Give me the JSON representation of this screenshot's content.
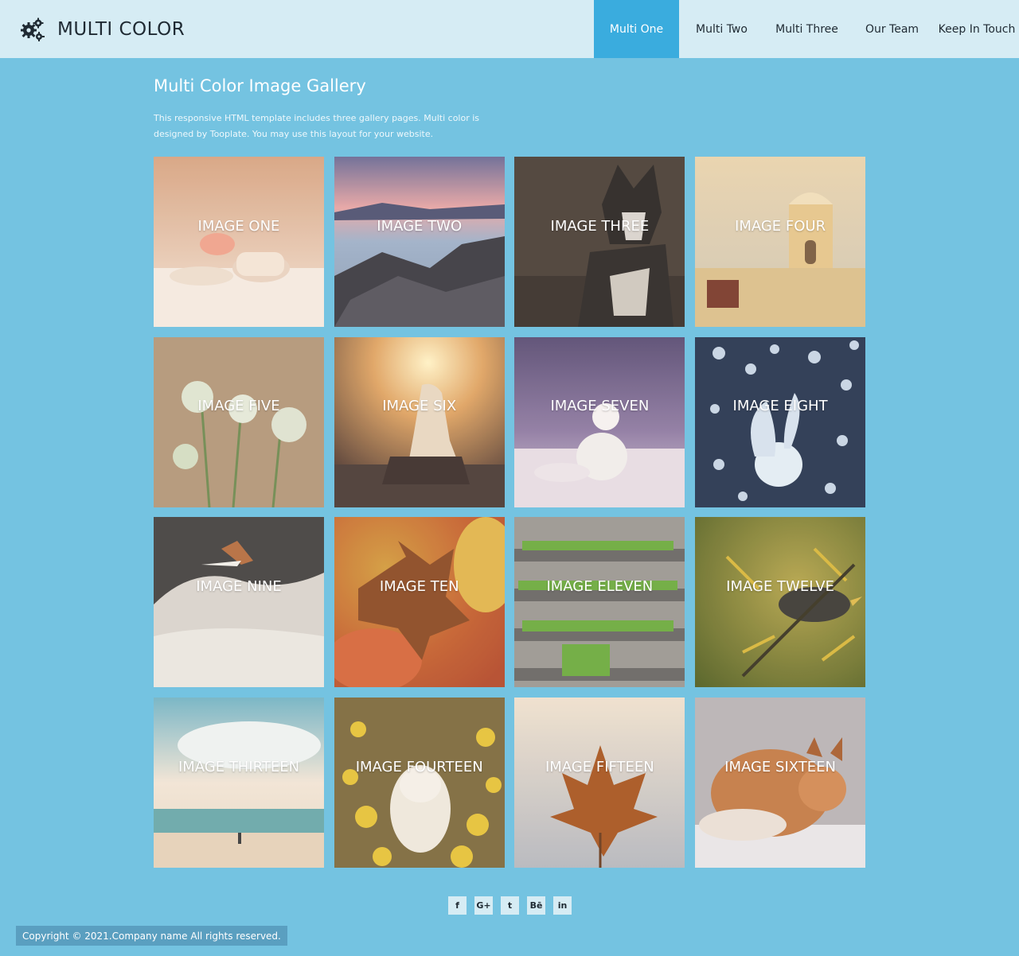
{
  "header": {
    "brand": "MULTI COLOR",
    "brand_icon": "gears-icon",
    "nav": [
      {
        "label": "Multi One",
        "active": true
      },
      {
        "label": "Multi Two",
        "active": false
      },
      {
        "label": "Multi Three",
        "active": false
      },
      {
        "label": "Our Team",
        "active": false
      },
      {
        "label": "Keep In Touch",
        "active": false
      }
    ]
  },
  "intro": {
    "title": "Multi Color Image Gallery",
    "description": "This responsive HTML template includes three gallery pages. Multi color is designed by Tooplate. You may use this layout for your website."
  },
  "gallery": [
    {
      "label": "IMAGE ONE"
    },
    {
      "label": "IMAGE TWO"
    },
    {
      "label": "IMAGE THREE"
    },
    {
      "label": "IMAGE FOUR"
    },
    {
      "label": "IMAGE FIVE"
    },
    {
      "label": "IMAGE SIX"
    },
    {
      "label": "IMAGE SEVEN"
    },
    {
      "label": "IMAGE EIGHT"
    },
    {
      "label": "IMAGE NINE"
    },
    {
      "label": "IMAGE TEN"
    },
    {
      "label": "IMAGE ELEVEN"
    },
    {
      "label": "IMAGE TWELVE"
    },
    {
      "label": "IMAGE THIRTEEN"
    },
    {
      "label": "IMAGE FOURTEEN"
    },
    {
      "label": "IMAGE FIFTEEN"
    },
    {
      "label": "IMAGE SIXTEEN"
    }
  ],
  "social": [
    {
      "icon": "facebook-icon",
      "glyph": "f"
    },
    {
      "icon": "google-plus-icon",
      "glyph": "G+"
    },
    {
      "icon": "twitter-icon",
      "glyph": "t"
    },
    {
      "icon": "behance-icon",
      "glyph": "Bē"
    },
    {
      "icon": "linkedin-icon",
      "glyph": "in"
    }
  ],
  "footer": {
    "copyright": "Copyright © 2021.Company name All rights reserved."
  },
  "colors": {
    "page_bg": "#74c3e1",
    "header_bg": "#d6ecf4",
    "nav_active": "#3aacde"
  }
}
